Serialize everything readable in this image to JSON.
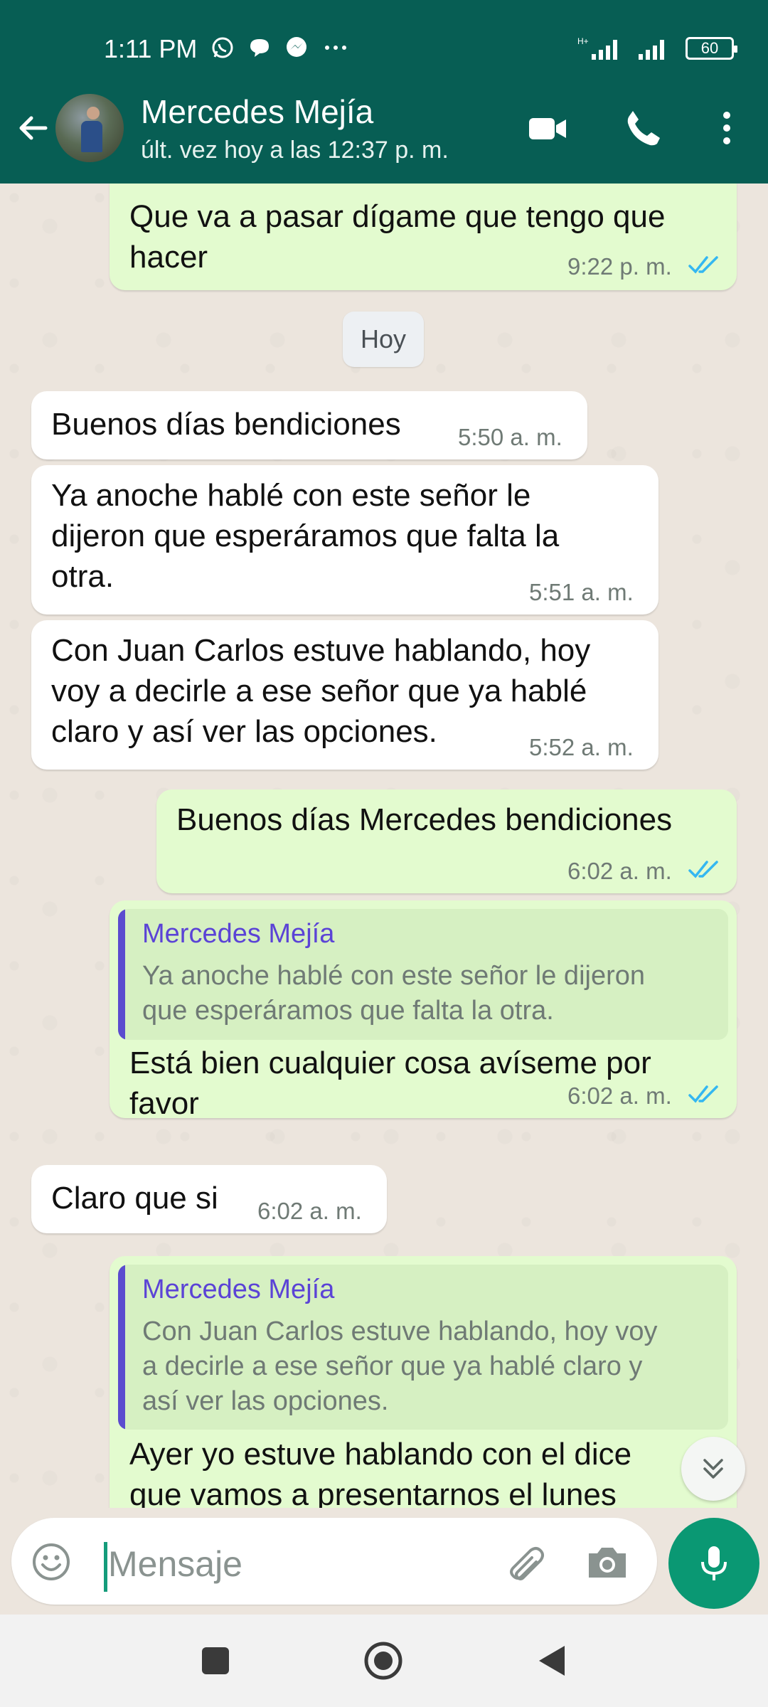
{
  "status_bar": {
    "time": "1:11 PM",
    "network": "H+",
    "battery": "60"
  },
  "header": {
    "name": "Mercedes Mejía",
    "last_seen": "últ. vez hoy a las 12:37 p. m."
  },
  "date_chip": "Hoy",
  "messages": [
    {
      "id": "m1",
      "direction": "out",
      "text_lines": [
        "Que va a pasar dígame que tengo que",
        "hacer"
      ],
      "time": "9:22 p. m.",
      "read": true
    },
    {
      "id": "m2",
      "direction": "in",
      "text_lines": [
        "Buenos días bendiciones"
      ],
      "time": "5:50 a. m."
    },
    {
      "id": "m3",
      "direction": "in",
      "text_lines": [
        "Ya anoche hablé con este señor le",
        "dijeron que esperáramos que falta la",
        "otra."
      ],
      "time": "5:51 a. m."
    },
    {
      "id": "m4",
      "direction": "in",
      "text_lines": [
        "Con Juan Carlos estuve hablando, hoy",
        "voy a decirle a ese señor que ya hablé",
        "claro y así ver las opciones."
      ],
      "time": "5:52 a. m."
    },
    {
      "id": "m5",
      "direction": "out",
      "text_lines": [
        "Buenos días Mercedes bendiciones"
      ],
      "time": "6:02 a. m.",
      "read": true
    },
    {
      "id": "m6",
      "direction": "out",
      "quote": {
        "author": "Mercedes Mejía",
        "lines": [
          "Ya anoche hablé con este señor le dijeron",
          "que esperáramos que falta la otra."
        ]
      },
      "text_lines": [
        "Está bien cualquier cosa avíseme por",
        "favor"
      ],
      "time": "6:02 a. m.",
      "read": true
    },
    {
      "id": "m7",
      "direction": "in",
      "text_lines": [
        "Claro que si"
      ],
      "time": "6:02 a. m."
    },
    {
      "id": "m8",
      "direction": "out",
      "quote": {
        "author": "Mercedes Mejía",
        "lines": [
          "Con Juan Carlos estuve hablando, hoy voy",
          "a decirle a ese señor que ya hablé claro y",
          "así ver las opciones."
        ]
      },
      "text_lines": [
        "Ayer yo estuve hablando con el dice",
        "que vamos a presentarnos el lunes"
      ],
      "time": "",
      "read": true
    }
  ],
  "composer": {
    "placeholder": "Mensaje"
  },
  "icons": {
    "back": "arrow-left-icon",
    "video": "video-camera-icon",
    "call": "phone-icon",
    "menu": "more-vert-icon",
    "emoji": "emoji-icon",
    "attach": "paperclip-icon",
    "camera": "camera-icon",
    "mic": "microphone-icon",
    "scroll": "double-chevron-down-icon"
  },
  "colors": {
    "header": "#075e54",
    "outgoing": "#e3fbcf",
    "incoming": "#ffffff",
    "accent": "#0a9873",
    "read_ticks": "#34b7f1",
    "quote_author": "#5b43d6"
  }
}
